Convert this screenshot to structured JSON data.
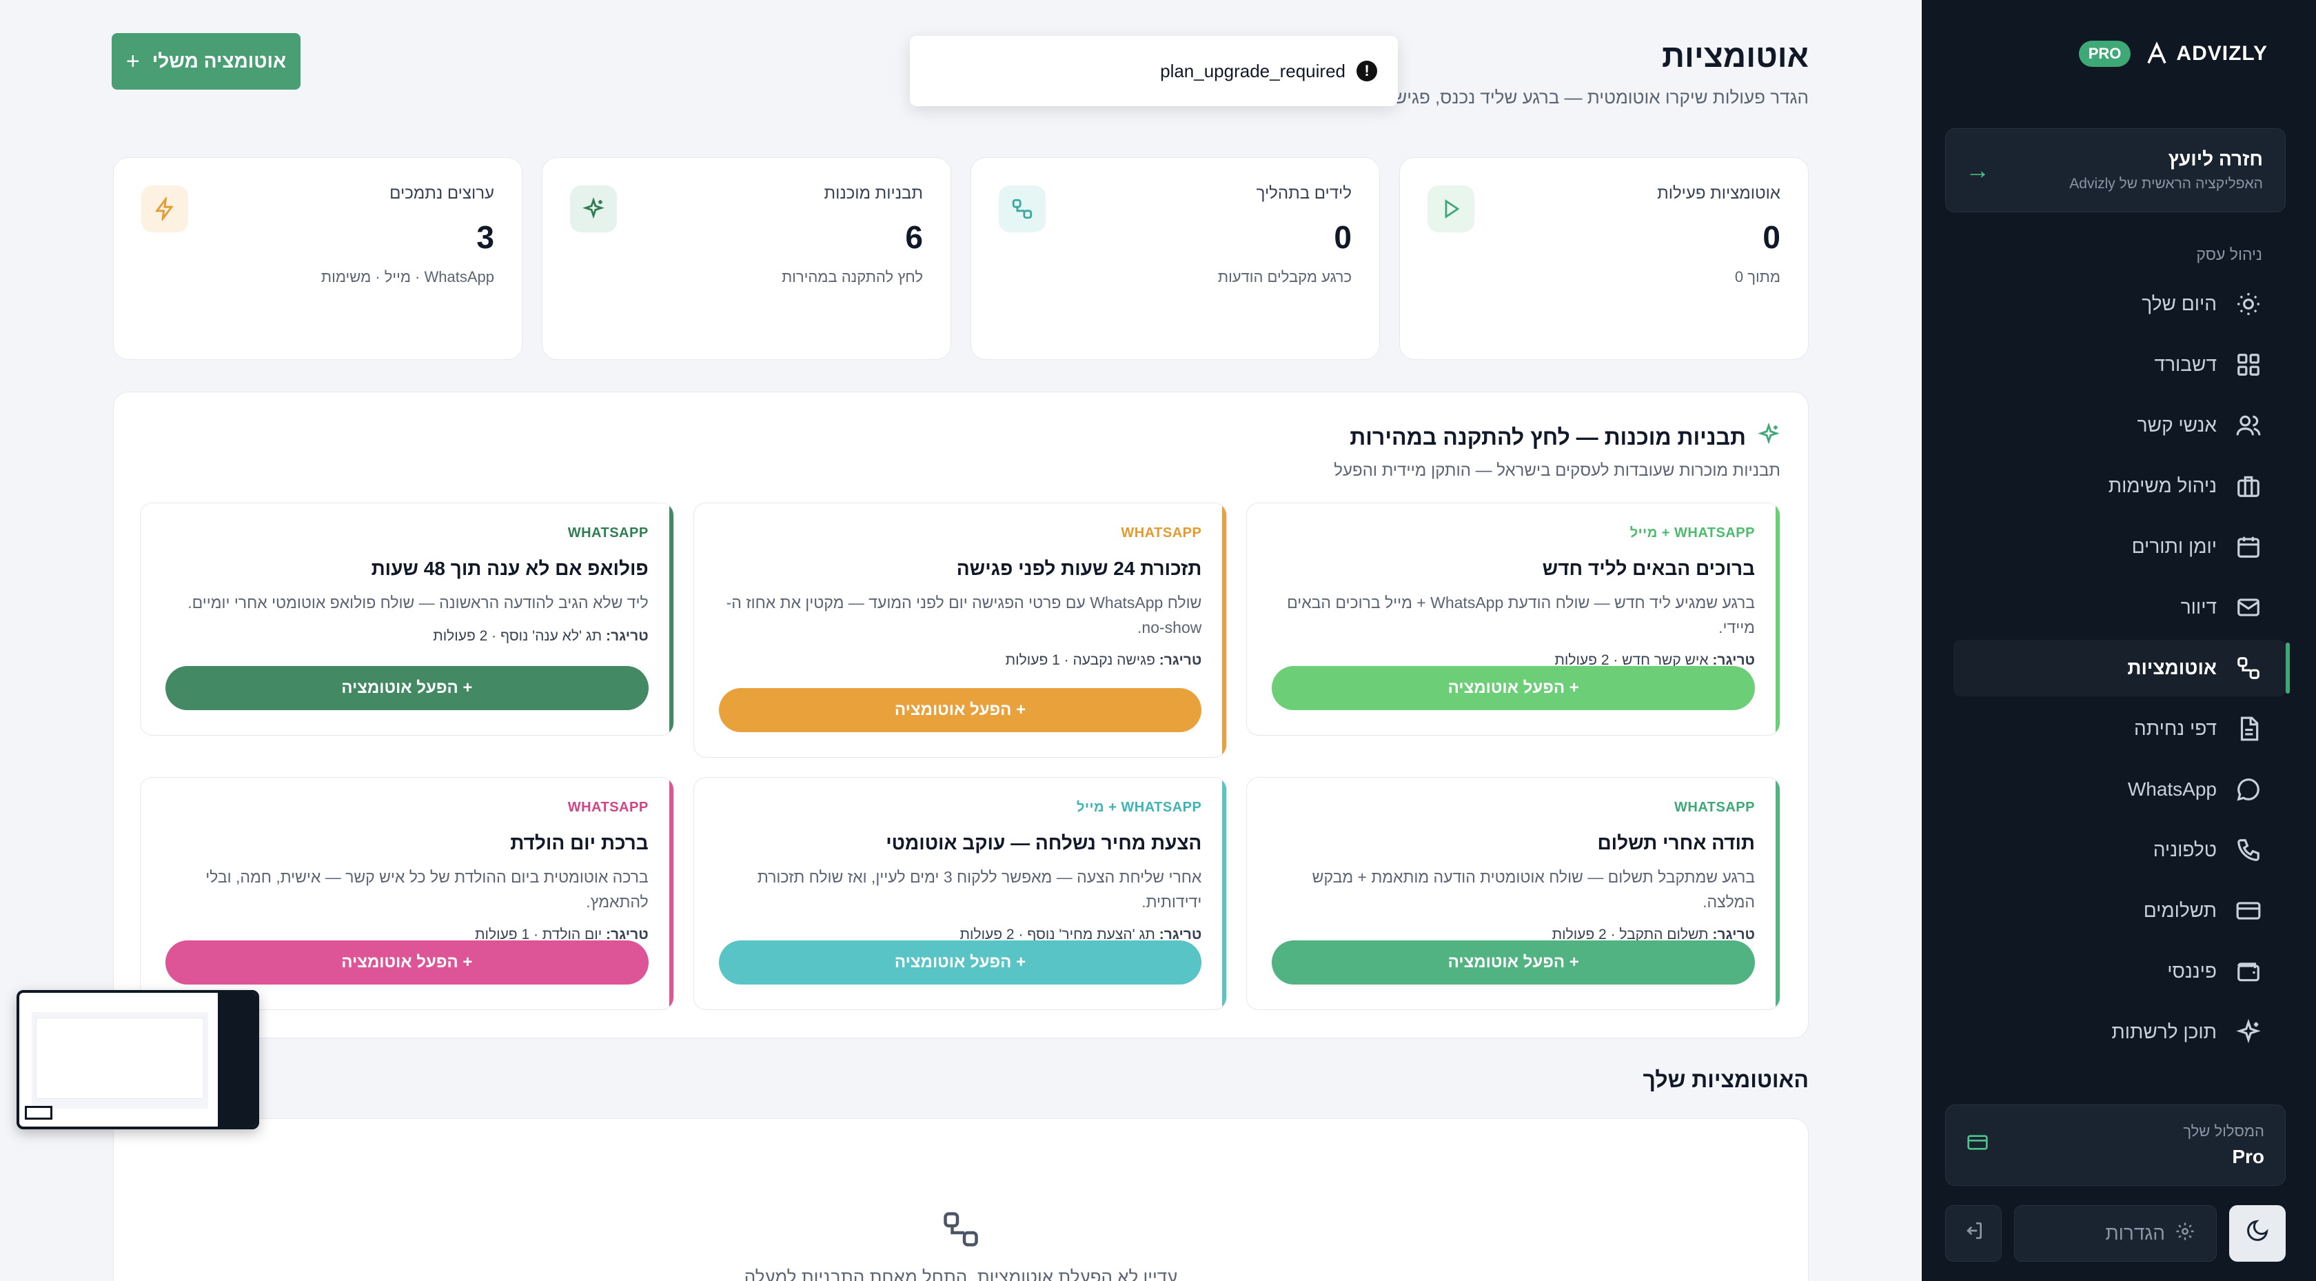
{
  "colors": {
    "sidebar_bg": "#0f1722",
    "brand_green": "#3fa877",
    "page_bg": "#f3f5f8"
  },
  "sidebar": {
    "logo_text": "ADVIZLY",
    "plan_badge": "PRO",
    "back_card": {
      "title": "חזרה ליועץ",
      "subtitle": "האפליקציה הראשית של Advizly",
      "icon": "arrow-right-icon"
    },
    "section_label": "ניהול עסק",
    "items": [
      {
        "label": "היום שלך",
        "icon": "sun-icon"
      },
      {
        "label": "דשבורד",
        "icon": "grid-icon"
      },
      {
        "label": "אנשי קשר",
        "icon": "users-icon"
      },
      {
        "label": "ניהול משימות",
        "icon": "briefcase-icon"
      },
      {
        "label": "יומן ותורים",
        "icon": "calendar-icon"
      },
      {
        "label": "דיוור",
        "icon": "mail-icon"
      },
      {
        "label": "אוטומציות",
        "icon": "workflow-icon",
        "active": true
      },
      {
        "label": "דפי נחיתה",
        "icon": "file-icon"
      },
      {
        "label": "WhatsApp",
        "icon": "chat-icon"
      },
      {
        "label": "טלפוניה",
        "icon": "phone-icon"
      },
      {
        "label": "תשלומים",
        "icon": "credit-card-icon"
      },
      {
        "label": "פיננסי",
        "icon": "wallet-icon"
      },
      {
        "label": "תוכן לרשתות",
        "icon": "sparkles-icon"
      }
    ],
    "plan_card": {
      "label": "המסלול שלך",
      "value": "Pro"
    },
    "settings_label": "הגדרות"
  },
  "header": {
    "title": "אוטומציות",
    "subtitle": "הגדר פעולות שיקרו אוטומטית — ברגע שליד נכנס, פגישה נ",
    "my_automation_button": "אוטומציה משלי"
  },
  "toast": {
    "message": "plan_upgrade_required"
  },
  "stats": [
    {
      "label": "אוטומציות פעילות",
      "value": "0",
      "sub": "מתוך 0",
      "icon": "play-icon",
      "color": "#3fa877",
      "bg": "#e8f6ee"
    },
    {
      "label": "לידים בתהליך",
      "value": "0",
      "sub": "כרגע מקבלים הודעות",
      "icon": "workflow-icon",
      "color": "#3aa7a0",
      "bg": "#e6f6f4"
    },
    {
      "label": "תבניות מוכנות",
      "value": "6",
      "sub": "לחץ להתקנה במהירות",
      "icon": "sparkles-icon",
      "color": "#2f7d55",
      "bg": "#e6f2ec"
    },
    {
      "label": "ערוצים נתמכים",
      "value": "3",
      "sub": "WhatsApp · מייל · משימות",
      "icon": "bolt-icon",
      "color": "#e39b2f",
      "bg": "#fdf2e2"
    }
  ],
  "templates_panel": {
    "title": "תבניות מוכנות — לחץ להתקנה במהירות",
    "subtitle": "תבניות מוכרות שעובדות לעסקים בישראל — הותקן מיידית והפעל",
    "cards": [
      {
        "channel": "WHATSAPP + מייל",
        "title": "ברוכים הבאים לליד חדש",
        "desc": "ברגע שמגיע ליד חדש — שולח הודעת WhatsApp + מייל ברוכים הבאים מיידי.",
        "trigger_label": "טריגר:",
        "trigger": "איש קשר חדש · 2 פעולות",
        "button": "+ הפעל אוטומציה",
        "color": "#6ccf78"
      },
      {
        "channel": "WHATSAPP",
        "title": "תזכורת 24 שעות לפני פגישה",
        "desc": "שולח WhatsApp עם פרטי הפגישה יום לפני המועד — מקטין את אחוז ה-no-show.",
        "trigger_label": "טריגר:",
        "trigger": "פגישה נקבעה · 1 פעולות",
        "button": "+ הפעל אוטומציה",
        "color": "#e9a13b"
      },
      {
        "channel": "WHATSAPP",
        "title": "פולואפ אם לא ענה תוך 48 שעות",
        "desc": "ליד שלא הגיב להודעה הראשונה — שולח פולואפ אוטומטי אחרי יומיים.",
        "trigger_label": "טריגר:",
        "trigger": "תג 'לא ענה' נוסף · 2 פעולות",
        "button": "+ הפעל אוטומציה",
        "color": "#438a64"
      },
      {
        "channel": "WHATSAPP",
        "title": "תודה אחרי תשלום",
        "desc": "ברגע שמתקבל תשלום — שולח אוטומטית הודעה מותאמת + מבקש המלצה.",
        "trigger_label": "טריגר:",
        "trigger": "תשלום התקבל · 2 פעולות",
        "button": "+ הפעל אוטומציה",
        "color": "#52b382"
      },
      {
        "channel": "WHATSAPP + מייל",
        "title": "הצעת מחיר נשלחה — עוקב אוטומטי",
        "desc": "אחרי שליחת הצעה — מאפשר ללקוח 3 ימים לעיין, ואז שולח תזכורת ידידותית.",
        "trigger_label": "טריגר:",
        "trigger": "תג 'הצעת מחיר' נוסף · 2 פעולות",
        "button": "+ הפעל אוטומציה",
        "color": "#58c4c6"
      },
      {
        "channel": "WHATSAPP",
        "title": "ברכת יום הולדת",
        "desc": "ברכה אוטומטית ביום ההולדת של כל איש קשר — אישית, חמה, ובלי להתאמץ.",
        "trigger_label": "טריגר:",
        "trigger": "יום הולדת · 1 פעולות",
        "button": "+ הפעל אוטומציה",
        "color": "#dd5597"
      }
    ]
  },
  "your_automations": {
    "title": "האוטומציות שלך",
    "empty_text": "עדיין לא הפעלת אוטומציות. התחל מאחת התבניות למעלה"
  }
}
